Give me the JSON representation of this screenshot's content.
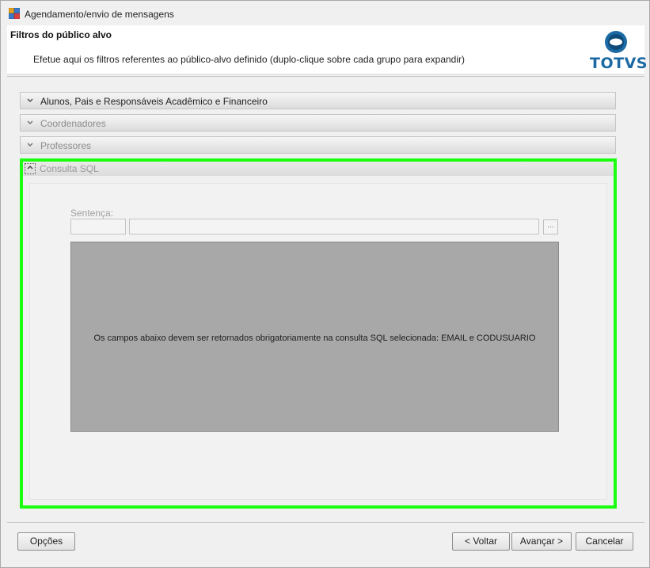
{
  "window": {
    "title": "Agendamento/envio de mensagens"
  },
  "header": {
    "title": "Filtros do público alvo",
    "description": "Efetue aqui os filtros referentes ao público-alvo definido (duplo-clique sobre cada grupo para expandir)",
    "logo_text": "TOTVS"
  },
  "groups": [
    {
      "label": "Alunos, Pais e Responsáveis Acadêmico e Financeiro",
      "state": "collapsed"
    },
    {
      "label": "Coordenadores",
      "state": "collapsed"
    },
    {
      "label": "Professores",
      "state": "collapsed"
    }
  ],
  "sql_group": {
    "label": "Consulta SQL",
    "state": "expanded",
    "sentenca_label": "Sentença:",
    "code_value": "",
    "name_value": "",
    "browse_label": "...",
    "message": "Os campos abaixo devem ser retornados obrigatoriamente na consulta SQL selecionada: EMAIL e CODUSUARIO"
  },
  "footer": {
    "options_label": "Opções",
    "back_label": "< Voltar",
    "next_label": "Avançar >",
    "cancel_label": "Cancelar"
  },
  "icons": {
    "app": "app-window-icon",
    "chevron_collapsed": "chevron-down-icon",
    "chevron_expanded": "chevron-up-icon"
  },
  "colors": {
    "highlight_border": "#1bff10",
    "logo_blue": "#1c6aa3",
    "message_panel": "#a8a8a8"
  }
}
